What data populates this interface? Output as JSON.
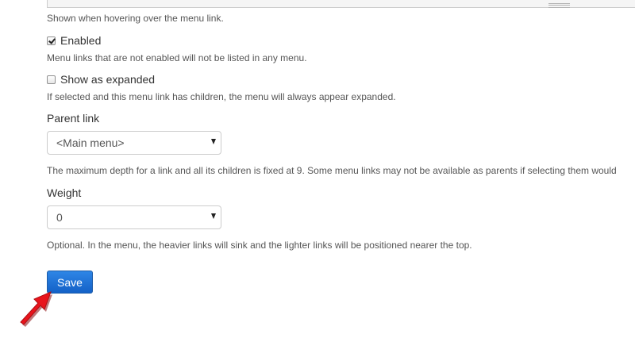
{
  "title_field": {
    "description": "Shown when hovering over the menu link."
  },
  "enabled": {
    "label": "Enabled",
    "checked": true,
    "description": "Menu links that are not enabled will not be listed in any menu."
  },
  "expanded": {
    "label": "Show as expanded",
    "checked": false,
    "description": "If selected and this menu link has children, the menu will always appear expanded."
  },
  "parent_link": {
    "label": "Parent link",
    "selected": "<Main menu>",
    "description": "The maximum depth for a link and all its children is fixed at 9. Some menu links may not be available as parents if selecting them would"
  },
  "weight": {
    "label": "Weight",
    "selected": "0",
    "description": "Optional. In the menu, the heavier links will sink and the lighter links will be positioned nearer the top."
  },
  "actions": {
    "save_label": "Save"
  },
  "annotation": {
    "icon": "red-pointer-arrow-icon",
    "color": "#e8141c"
  }
}
